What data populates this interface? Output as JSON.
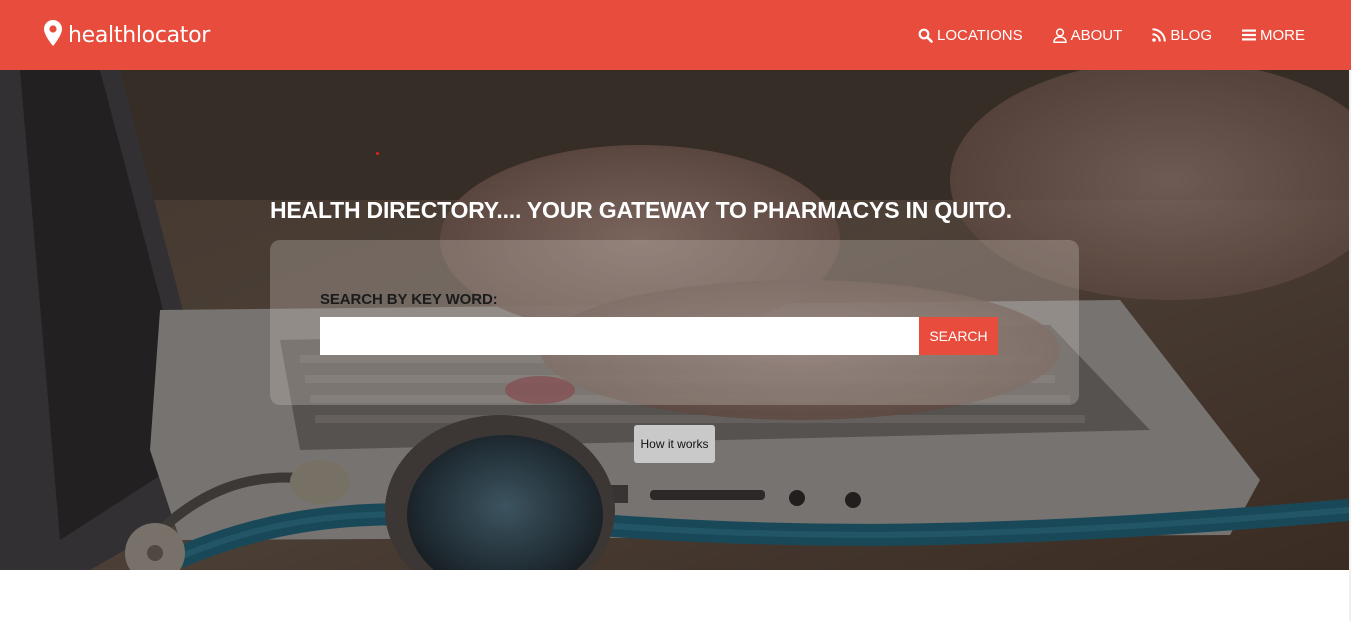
{
  "brand": {
    "icon": "map-pin-icon",
    "name": "healthlocator"
  },
  "nav": {
    "items": [
      {
        "icon": "search-icon",
        "label": "LOCATIONS"
      },
      {
        "icon": "user-icon",
        "label": "ABOUT"
      },
      {
        "icon": "rss-icon",
        "label": "BLOG"
      },
      {
        "icon": "menu-icon",
        "label": "MORE"
      }
    ]
  },
  "hero": {
    "headline": "HEALTH DIRECTORY.... YOUR GATEWAY TO PHARMACYS IN QUITO.",
    "search_label": "SEARCH BY KEY WORD:",
    "search_value": "",
    "search_button": "SEARCH",
    "how_button": "How it works"
  },
  "colors": {
    "accent": "#e74c3c",
    "panel": "rgba(200,190,185,0.33)",
    "how_button_bg": "#c9c9c9"
  }
}
